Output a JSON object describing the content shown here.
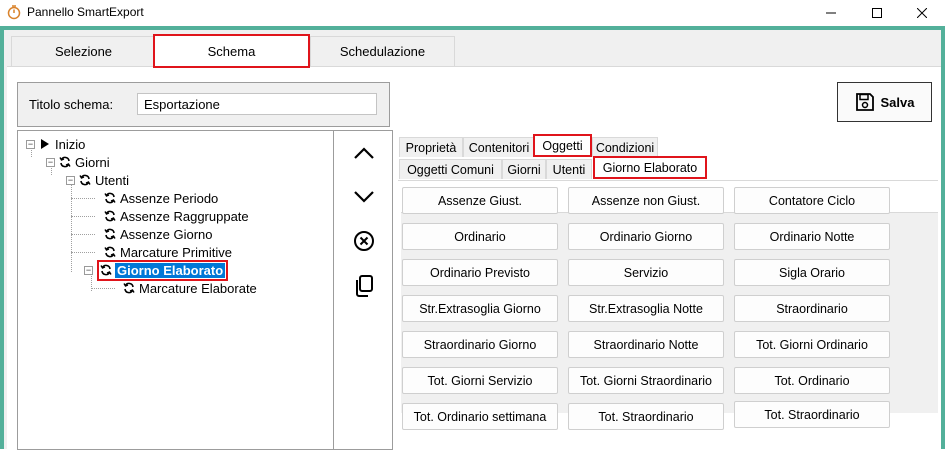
{
  "window": {
    "title": "Pannello SmartExport",
    "app_icon": "timer-icon",
    "controls": [
      "minimize-icon",
      "maximize-icon",
      "close-icon"
    ]
  },
  "main_tabs": [
    {
      "label": "Selezione",
      "selected": false
    },
    {
      "label": "Schema",
      "selected": true
    },
    {
      "label": "Schedulazione",
      "selected": false
    }
  ],
  "schema": {
    "label": "Titolo schema:",
    "value": "Esportazione"
  },
  "save_button": {
    "label": "Salva",
    "icon": "floppy-disk-icon"
  },
  "tree": {
    "nodes": [
      {
        "label": "Inizio",
        "icon": "play-icon"
      },
      {
        "label": "Giorni",
        "icon": "refresh-icon"
      },
      {
        "label": "Utenti",
        "icon": "refresh-icon"
      },
      {
        "label": "Assenze Periodo",
        "icon": "refresh-icon"
      },
      {
        "label": "Assenze Raggruppate",
        "icon": "refresh-icon"
      },
      {
        "label": "Assenze Giorno",
        "icon": "refresh-icon"
      },
      {
        "label": "Marcature Primitive",
        "icon": "refresh-icon"
      },
      {
        "label": "Giorno Elaborato",
        "icon": "refresh-icon",
        "selected": true
      },
      {
        "label": "Marcature Elaborate",
        "icon": "refresh-icon"
      }
    ]
  },
  "side_buttons": [
    "chevron-up-icon",
    "chevron-down-icon",
    "circle-x-icon",
    "copy-icon"
  ],
  "right_tabs": [
    {
      "label": "Proprietà",
      "selected": false
    },
    {
      "label": "Contenitori",
      "selected": false
    },
    {
      "label": "Oggetti",
      "selected": true
    },
    {
      "label": "Condizioni",
      "selected": false
    }
  ],
  "sub_tabs": [
    {
      "label": "Oggetti Comuni",
      "selected": false
    },
    {
      "label": "Giorni",
      "selected": false
    },
    {
      "label": "Utenti",
      "selected": false
    },
    {
      "label": "Giorno Elaborato",
      "selected": true
    }
  ],
  "objects": [
    "Assenze Giust.",
    "Assenze non Giust.",
    "Contatore Ciclo",
    "Ordinario",
    "Ordinario Giorno",
    "Ordinario Notte",
    "Ordinario Previsto",
    "Servizio",
    "Sigla Orario",
    "Str.Extrasoglia Giorno",
    "Str.Extrasoglia Notte",
    "Straordinario",
    "Straordinario Giorno",
    "Straordinario Notte",
    "Tot. Giorni Ordinario",
    "Tot. Giorni Servizio",
    "Tot. Giorni Straordinario",
    "Tot. Ordinario",
    "Tot. Ordinario settimana",
    "Tot. Straordinario",
    "Tot. Straordinario"
  ],
  "colors": {
    "frame": "#53b09a",
    "highlight": "#e0141b",
    "selection": "#0078d7"
  }
}
